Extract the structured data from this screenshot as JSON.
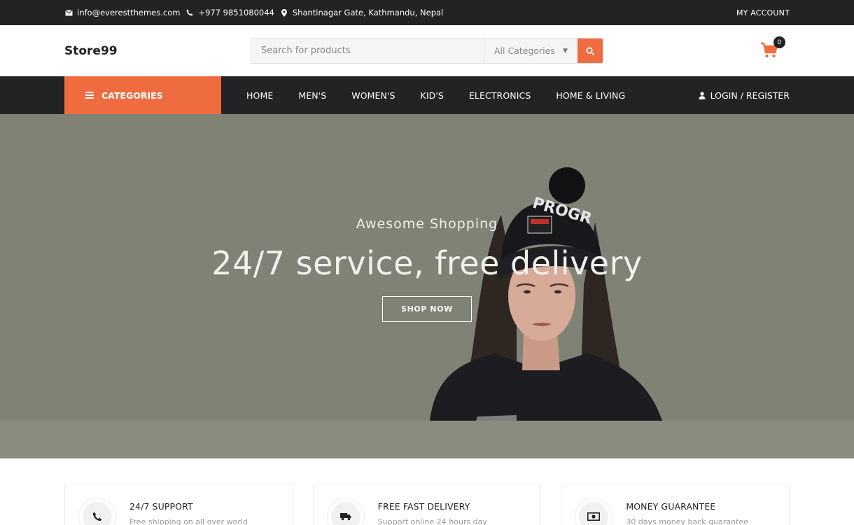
{
  "topbar": {
    "email": "info@everestthemes.com",
    "phone": "+977 9851080044",
    "address": "Shantinagar Gate, Kathmandu, Nepal",
    "account": "MY ACCOUNT"
  },
  "header": {
    "logo": "Store99",
    "search_placeholder": "Search for products",
    "category_select": "All Categories",
    "cart_count": "0"
  },
  "nav": {
    "categories_label": "CATEGORIES",
    "items": [
      "HOME",
      "MEN'S",
      "WOMEN'S",
      "KID'S",
      "ELECTRONICS",
      "HOME & LIVING"
    ],
    "login": "LOGIN / REGISTER"
  },
  "hero": {
    "subtitle": "Awesome Shopping",
    "title": "24/7 service, free delivery",
    "button": "SHOP NOW"
  },
  "features": [
    {
      "title": "24/7 SUPPORT",
      "desc": "Free shipping on all over world"
    },
    {
      "title": "FREE FAST DELIVERY",
      "desc": "Support online 24 hours day"
    },
    {
      "title": "MONEY GUARANTEE",
      "desc": "30 days money back guarantee"
    }
  ],
  "colors": {
    "accent": "#ef6c41",
    "dark": "#222324",
    "hero_bg": "#818276"
  }
}
